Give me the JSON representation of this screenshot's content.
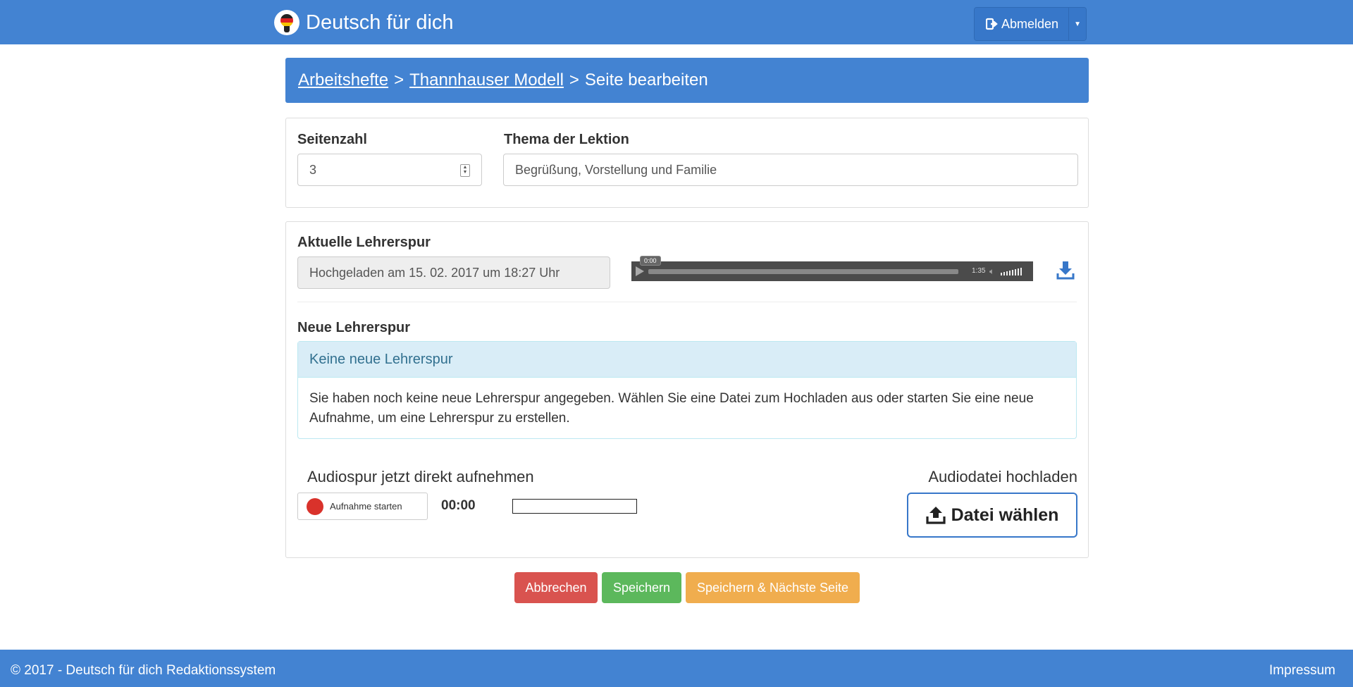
{
  "header": {
    "brand_title": "Deutsch für dich",
    "logout_label": "Abmelden",
    "brand_color": "#4383d2"
  },
  "breadcrumb": {
    "items": [
      "Arbeitshefte",
      "Thannhauser Modell"
    ],
    "separator": ">",
    "current": "Seite bearbeiten"
  },
  "page_form": {
    "page_number_label": "Seitenzahl",
    "page_number_value": "3",
    "topic_label": "Thema der Lektion",
    "topic_value": "Begrüßung, Vorstellung und Familie"
  },
  "teacher_track": {
    "current_label": "Aktuelle Lehrerspur",
    "uploaded_text": "Hochgeladen am 15. 02. 2017 um 18:27 Uhr",
    "player": {
      "current_time": "0:00",
      "duration": "1:35",
      "progress_fraction": 0
    },
    "new_label": "Neue Lehrerspur",
    "alert_title": "Keine neue Lehrerspur",
    "alert_text": "Sie haben noch keine neue Lehrerspur angegeben. Wählen Sie eine Datei zum Hochladen aus oder starten Sie eine neue Aufnahme, um eine Lehrerspur zu erstellen.",
    "record_title": "Audiospur jetzt direkt aufnehmen",
    "record_button": "Aufnahme starten",
    "record_timer": "00:00",
    "upload_title": "Audiodatei hochladen",
    "upload_button": "Datei wählen"
  },
  "actions": {
    "cancel": "Abbrechen",
    "save": "Speichern",
    "save_next": "Speichern & Nächste Seite"
  },
  "footer": {
    "copyright": "© 2017 - Deutsch für dich Redaktionssystem",
    "impressum": "Impressum"
  }
}
